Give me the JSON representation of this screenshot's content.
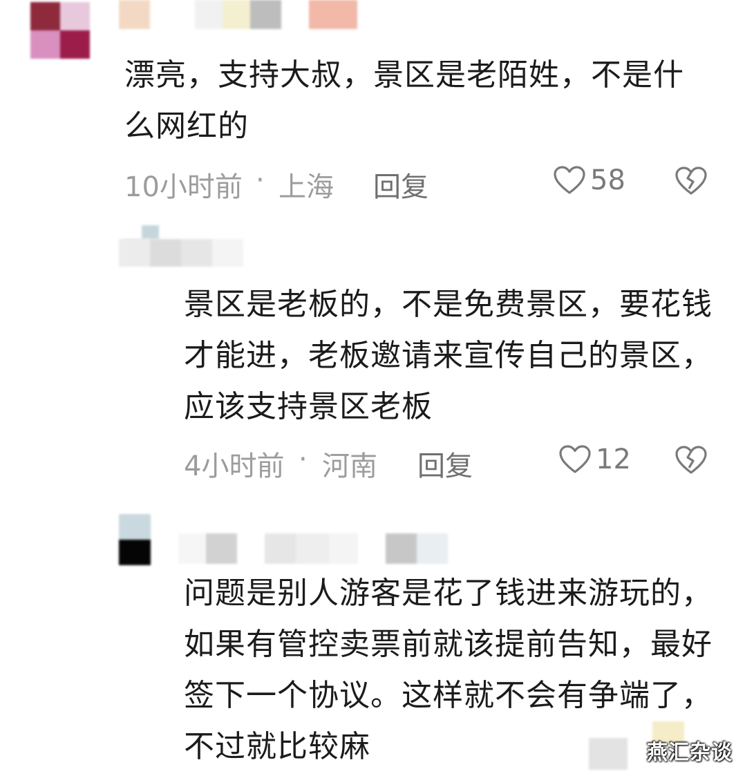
{
  "comments": [
    {
      "text": "漂亮，支持大叔，景区是老陌姓，不是什么网红的",
      "time": "10小时前",
      "location": "上海",
      "reply_label": "回复",
      "likes": "58"
    },
    {
      "text": "景区是老板的，不是免费景区，要花钱才能进，老板邀请来宣传自己的景区，应该支持景区老板",
      "time": "4小时前",
      "location": "河南",
      "reply_label": "回复",
      "likes": "12"
    },
    {
      "text": "问题是别人游客是花了钱进来游玩的，如果有管控卖票前就该提前告知，最好签下一个协议。这样就不会有争端了，不过就比较麻"
    }
  ],
  "separator": "·",
  "watermark": "燕汇杂谈",
  "icons": {
    "like": "heart-outline-icon",
    "dislike": "broken-heart-icon"
  }
}
